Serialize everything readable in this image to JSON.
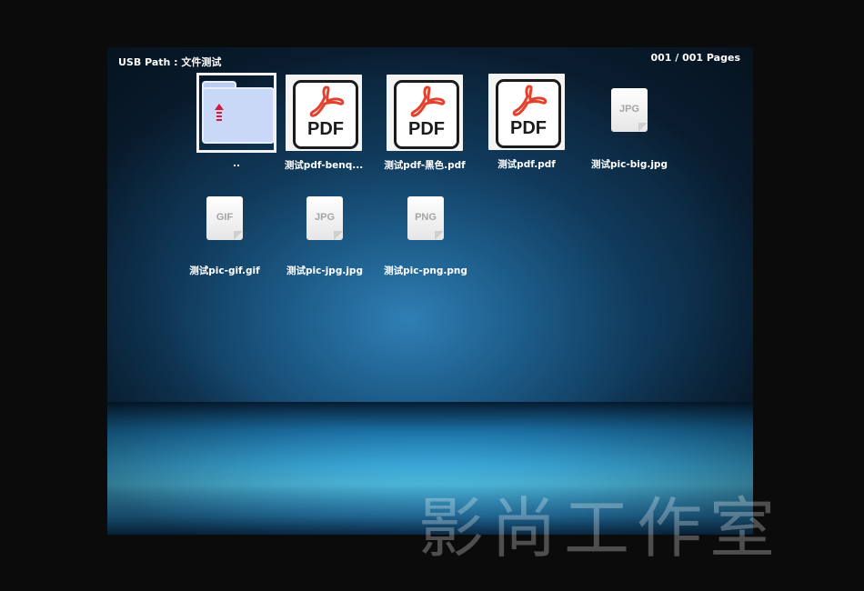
{
  "header": {
    "path_label": "USB Path : 文件测试",
    "pages_label": "001 / 001 Pages"
  },
  "files": [
    {
      "name": "..",
      "type": "folder-up",
      "selected": true
    },
    {
      "name": "测试pdf-benq...",
      "type": "pdf"
    },
    {
      "name": "测试pdf-黑色.pdf",
      "type": "pdf"
    },
    {
      "name": "测试pdf.pdf",
      "type": "pdf"
    },
    {
      "name": "测试pic-big.jpg",
      "type": "image",
      "badge": "JPG"
    },
    {
      "name": "测试pic-gif.gif",
      "type": "image",
      "badge": "GIF"
    },
    {
      "name": "测试pic-jpg.jpg",
      "type": "image",
      "badge": "JPG"
    },
    {
      "name": "测试pic-png.png",
      "type": "image",
      "badge": "PNG"
    }
  ],
  "pdf_icon_text": "PDF",
  "watermark": "影尚工作室",
  "colors": {
    "selection_border": "#f2f2f2",
    "folder_fill": "#c8d8f6",
    "up_arrow": "#d9183a",
    "pdf_symbol": "#e2412e",
    "background_blue": "#1d5d8a",
    "floor_glow": "#58d2fb"
  }
}
